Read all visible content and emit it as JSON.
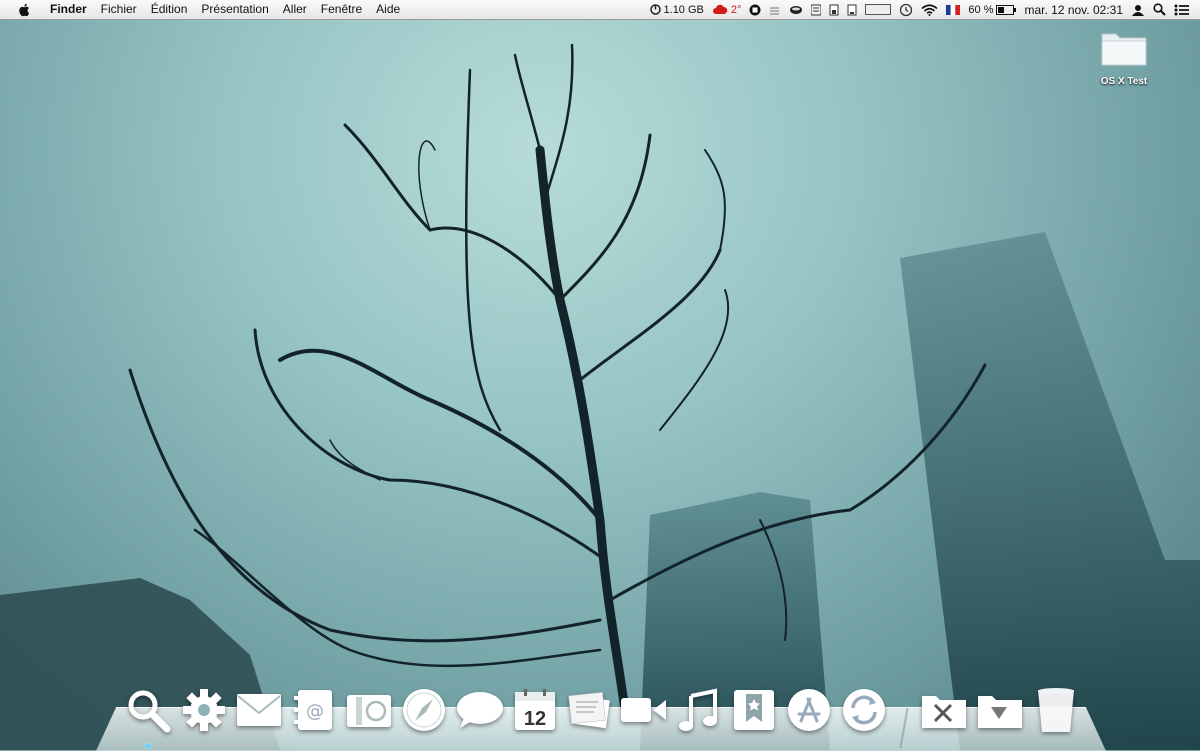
{
  "menubar": {
    "apple": "apple-icon",
    "items": [
      "Finder",
      "Fichier",
      "Édition",
      "Présentation",
      "Aller",
      "Fenêtre",
      "Aide"
    ],
    "status": {
      "memory": "1.10 GB",
      "temperature": "2°",
      "battery_percent": "60 %",
      "clock": "mar. 12 nov.  02:31"
    }
  },
  "desktop_icons": [
    {
      "label": "OS X Test",
      "icon": "folder-icon"
    }
  ],
  "dock": {
    "calendar_day": "12",
    "apps": [
      "spotlight",
      "system-preferences",
      "mail",
      "contacts",
      "photo-booth",
      "safari",
      "messages",
      "calendar",
      "notes",
      "facetime",
      "itunes",
      "bookmarks",
      "app-store",
      "sync",
      "utilities-folder",
      "downloads-folder",
      "trash"
    ]
  },
  "colors": {
    "temperature": "#d21d1d",
    "accent_dot": "#6bd3ff"
  }
}
